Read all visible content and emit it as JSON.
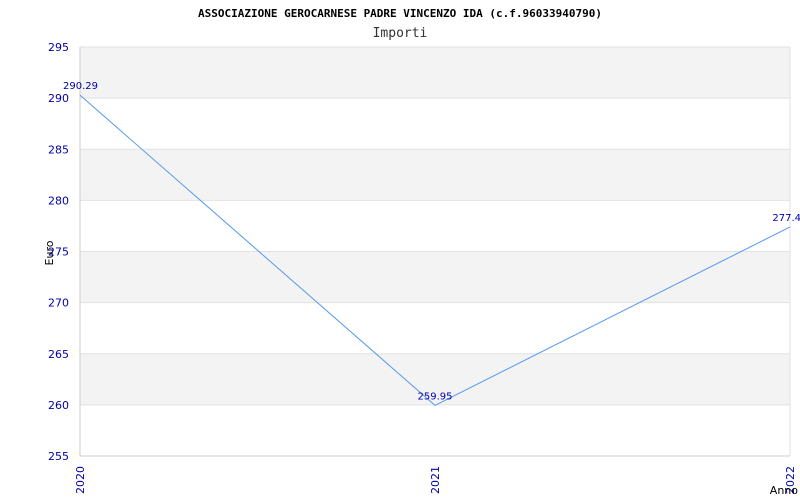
{
  "chart_data": {
    "type": "line",
    "title": "ASSOCIAZIONE GEROCARNESE PADRE VINCENZO IDA (c.f.96033940790)",
    "subtitle": "Importi",
    "xlabel": "Anno",
    "ylabel": "Euro",
    "categories": [
      "2020",
      "2021",
      "2022"
    ],
    "series": [
      {
        "values": [
          290.29,
          259.95,
          277.4
        ],
        "labels": [
          "290.29",
          "259.95",
          "277.4"
        ]
      }
    ],
    "ylim": [
      255,
      295
    ],
    "yticks": [
      255,
      260,
      265,
      270,
      275,
      280,
      285,
      290,
      295
    ],
    "grid": true,
    "line_color": "#5599ee",
    "tick_color": "#0000aa",
    "band_color": "#f3f3f3"
  }
}
